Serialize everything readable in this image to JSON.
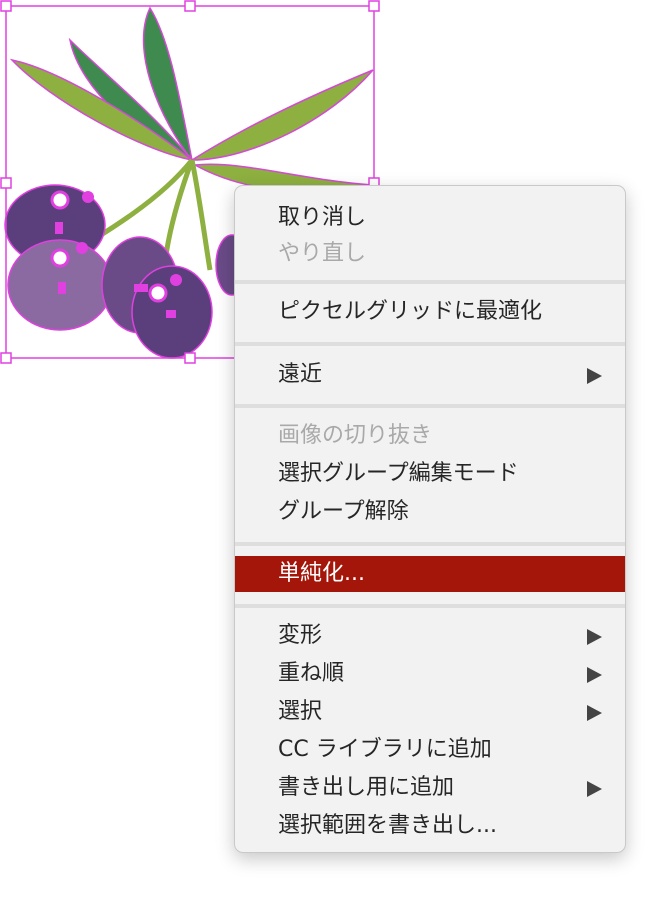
{
  "context_menu": {
    "items": [
      {
        "label": "取り消し",
        "enabled": true,
        "submenu": false
      },
      {
        "label": "やり直し",
        "enabled": false,
        "submenu": false
      },
      {
        "label": "ピクセルグリッドに最適化",
        "enabled": true,
        "submenu": false
      },
      {
        "label": "遠近",
        "enabled": true,
        "submenu": true
      },
      {
        "label": "画像の切り抜き",
        "enabled": false,
        "submenu": false
      },
      {
        "label": "選択グループ編集モード",
        "enabled": true,
        "submenu": false
      },
      {
        "label": "グループ解除",
        "enabled": true,
        "submenu": false
      },
      {
        "label": "単純化...",
        "enabled": true,
        "submenu": false,
        "highlighted": true
      },
      {
        "label": "変形",
        "enabled": true,
        "submenu": true
      },
      {
        "label": "重ね順",
        "enabled": true,
        "submenu": true
      },
      {
        "label": "選択",
        "enabled": true,
        "submenu": true
      },
      {
        "label": "CC ライブラリに追加",
        "enabled": true,
        "submenu": false
      },
      {
        "label": "書き出し用に追加",
        "enabled": true,
        "submenu": true
      },
      {
        "label": "選択範囲を書き出し...",
        "enabled": true,
        "submenu": false
      }
    ],
    "highlight_color": "#a4150a"
  },
  "artwork": {
    "subject": "olive branch illustration",
    "selection_color": "#e040e0",
    "leaf_colors": [
      "#3f8a4f",
      "#8db040"
    ],
    "olive_colors": [
      "#5b3f7d",
      "#8a6aa0"
    ]
  }
}
